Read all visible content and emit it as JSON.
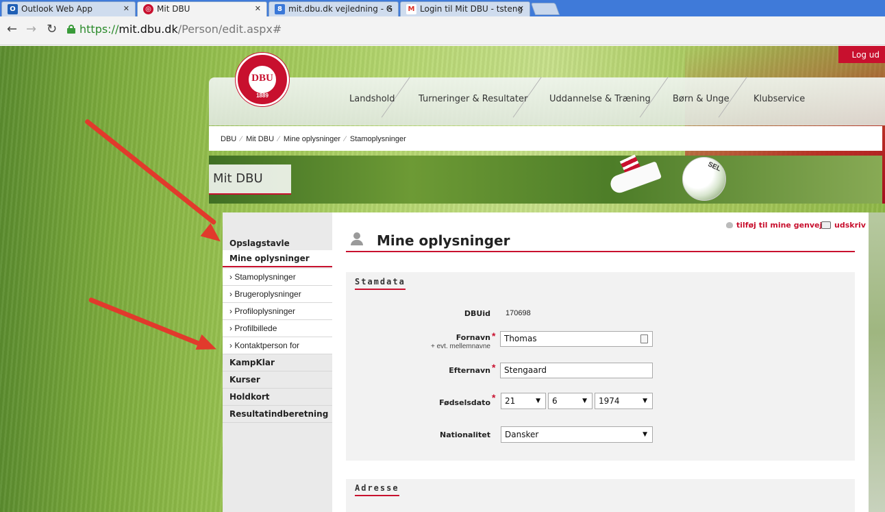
{
  "browser": {
    "tabs": [
      {
        "title": "Outlook Web App",
        "icon": "outlook-icon",
        "color": "#1f5fb5"
      },
      {
        "title": "Mit DBU",
        "icon": "dbu-icon",
        "color": "#c8102e"
      },
      {
        "title": "mit.dbu.dk vejledning - G",
        "icon": "google-icon",
        "color": "#3a78d8"
      },
      {
        "title": "Login til Mit DBU - tsteng",
        "icon": "gmail-icon",
        "color": "#d93025"
      }
    ],
    "url": {
      "scheme": "https://",
      "host": "mit.dbu.dk",
      "path": "/Person/edit.aspx#"
    }
  },
  "site": {
    "logo_text": "DBU",
    "logo_year": "1889",
    "nav": [
      "Landshold",
      "Turneringer & Resultater",
      "Uddannelse & Træning",
      "Børn & Unge",
      "Klubservice"
    ],
    "logout": "Log ud",
    "breadcrumb": [
      "DBU",
      "Mit DBU",
      "Mine oplysninger",
      "Stamoplysninger"
    ],
    "breadcrumb_sep": "⁄",
    "hero_title": "Mit DBU",
    "accent": "#c8102e"
  },
  "sidebar": {
    "items": [
      {
        "label": "Opslagstavle"
      },
      {
        "label": "Mine oplysninger"
      },
      {
        "label": "› Stamoplysninger"
      },
      {
        "label": "› Brugeroplysninger"
      },
      {
        "label": "› Profiloplysninger"
      },
      {
        "label": "› Profilbillede"
      },
      {
        "label": "› Kontaktperson for"
      },
      {
        "label": "KampKlar"
      },
      {
        "label": "Kurser"
      },
      {
        "label": "Holdkort"
      },
      {
        "label": "Resultatindberetning"
      }
    ]
  },
  "main": {
    "title": "Mine oplysninger",
    "tool_shortcut": "tilføj til mine genveje",
    "tool_print": "udskriv",
    "section1": "Stamdata",
    "section2": "Adresse",
    "fields": {
      "dbuid_label": "DBUid",
      "dbuid_value": "170698",
      "fornavn_label": "Fornavn",
      "fornavn_hint": "+ evt. mellemnavne",
      "fornavn_value": "Thomas",
      "efternavn_label": "Efternavn",
      "efternavn_value": "Stengaard",
      "birth_label": "Fødselsdato",
      "birth_day": "21",
      "birth_month": "6",
      "birth_year": "1974",
      "nationality_label": "Nationalitet",
      "nationality_value": "Dansker",
      "required_mark": "*"
    }
  }
}
